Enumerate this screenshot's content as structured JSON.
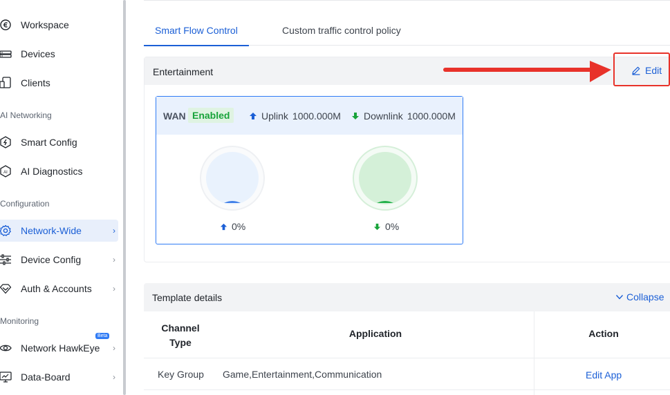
{
  "sidebar": {
    "items_top": [
      {
        "label": "Workspace",
        "icon": "workspace-icon"
      },
      {
        "label": "Devices",
        "icon": "devices-icon"
      },
      {
        "label": "Clients",
        "icon": "clients-icon"
      }
    ],
    "section_ai": "AI Networking",
    "items_ai": [
      {
        "label": "Smart Config",
        "icon": "smart-config-icon"
      },
      {
        "label": "AI Diagnostics",
        "icon": "ai-diagnostics-icon"
      }
    ],
    "section_config": "Configuration",
    "items_config": [
      {
        "label": "Network-Wide",
        "icon": "gear-icon",
        "active": true
      },
      {
        "label": "Device Config",
        "icon": "sliders-icon"
      },
      {
        "label": "Auth & Accounts",
        "icon": "shield-icon"
      }
    ],
    "section_monitoring": "Monitoring",
    "items_monitoring": [
      {
        "label": "Network HawkEye",
        "icon": "hawkeye-icon",
        "badge": "Beta"
      },
      {
        "label": "Data-Board",
        "icon": "dashboard-icon"
      }
    ]
  },
  "tabs": [
    "Smart Flow Control",
    "Custom traffic control policy"
  ],
  "card": {
    "title": "Entertainment",
    "edit_label": "Edit",
    "wan": {
      "label": "WAN",
      "status": "Enabled",
      "uplink_label": "Uplink",
      "uplink_value": "1000.000M",
      "downlink_label": "Downlink",
      "downlink_value": "1000.000M",
      "uplink_usage": "0%",
      "downlink_usage": "0%"
    }
  },
  "template": {
    "title": "Template details",
    "collapse_label": "Collapse",
    "columns": [
      "Channel Type",
      "Application",
      "Action"
    ],
    "rows": [
      {
        "channel_type": "Key Group",
        "application": "Game,Entertainment,Communication",
        "action": "Edit App"
      }
    ]
  },
  "colors": {
    "accent": "#1b5fd6",
    "enabled": "#18a33a",
    "annotation": "#e8322a"
  }
}
